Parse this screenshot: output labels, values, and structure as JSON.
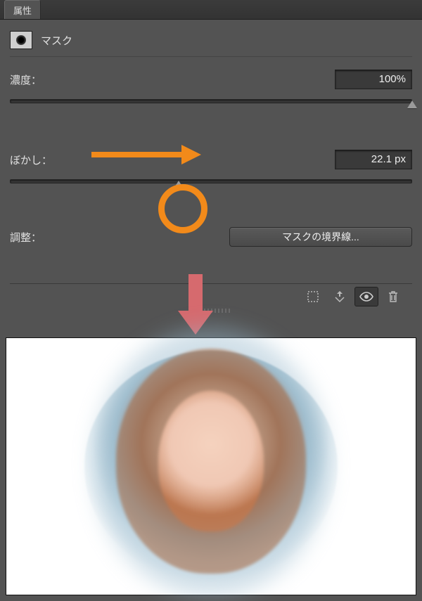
{
  "panel": {
    "tab_title": "属性",
    "mask_header_label": "マスク"
  },
  "density": {
    "label": "濃度：",
    "value": "100%",
    "slider_percent": 100
  },
  "feather": {
    "label": "ぼかし：",
    "value": "22.1 px",
    "slider_percent": 42
  },
  "adjust": {
    "label": "調整：",
    "button_label": "マスクの境界線..."
  }
}
